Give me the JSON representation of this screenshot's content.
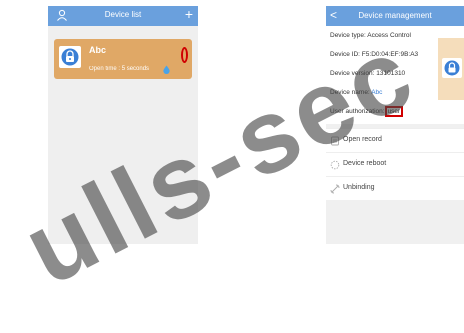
{
  "colors": {
    "header": "#6aa0dd",
    "card": "#e0a866",
    "highlight": "#d00000",
    "link": "#3a7fd5"
  },
  "device_list": {
    "title": "Device list",
    "user_icon": "user-icon",
    "add_icon": "plus-icon",
    "add_label": "+",
    "card": {
      "name": "Abc",
      "open_time_label": "Open time",
      "open_time_sep": ":",
      "open_time_value": "5 seconds",
      "lock_icon": "lock-icon",
      "status_icon": "drop-icon",
      "highlight_icon": "highlight-ellipse-icon"
    }
  },
  "device_management": {
    "back_label": "<",
    "title": "Device management",
    "info": {
      "type_label": "Device type:",
      "type_value": "Access Control",
      "id_label": "Device ID:",
      "id_value": "F5:D0:04:EF:9B:A3",
      "version_label": "Device version:",
      "version_value": "13101310",
      "name_label": "Device name:",
      "name_value": "Abc",
      "auth_label": "User authorization:",
      "auth_value": "user"
    },
    "preview_icon": "lock-icon",
    "menu": [
      {
        "label": "Open record",
        "icon": "record-icon"
      },
      {
        "label": "Device reboot",
        "icon": "reboot-icon"
      },
      {
        "label": "Unbinding",
        "icon": "unlink-icon"
      }
    ]
  },
  "watermark": {
    "text": "ulls-sec"
  }
}
